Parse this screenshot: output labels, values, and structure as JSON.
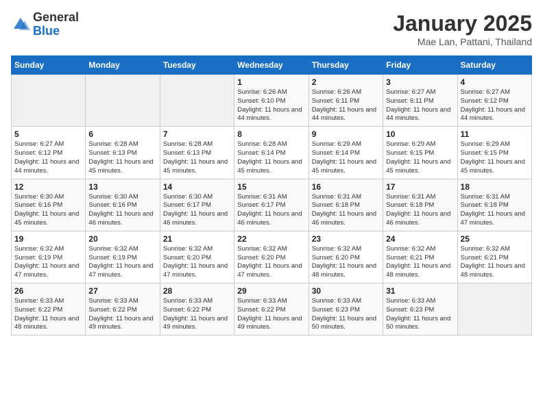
{
  "logo": {
    "general": "General",
    "blue": "Blue"
  },
  "header": {
    "title": "January 2025",
    "location": "Mae Lan, Pattani, Thailand"
  },
  "weekdays": [
    "Sunday",
    "Monday",
    "Tuesday",
    "Wednesday",
    "Thursday",
    "Friday",
    "Saturday"
  ],
  "weeks": [
    [
      {
        "day": "",
        "sunrise": "",
        "sunset": "",
        "daylight": "",
        "empty": true
      },
      {
        "day": "",
        "sunrise": "",
        "sunset": "",
        "daylight": "",
        "empty": true
      },
      {
        "day": "",
        "sunrise": "",
        "sunset": "",
        "daylight": "",
        "empty": true
      },
      {
        "day": "1",
        "sunrise": "Sunrise: 6:26 AM",
        "sunset": "Sunset: 6:10 PM",
        "daylight": "Daylight: 11 hours and 44 minutes.",
        "empty": false
      },
      {
        "day": "2",
        "sunrise": "Sunrise: 6:26 AM",
        "sunset": "Sunset: 6:11 PM",
        "daylight": "Daylight: 11 hours and 44 minutes.",
        "empty": false
      },
      {
        "day": "3",
        "sunrise": "Sunrise: 6:27 AM",
        "sunset": "Sunset: 6:11 PM",
        "daylight": "Daylight: 11 hours and 44 minutes.",
        "empty": false
      },
      {
        "day": "4",
        "sunrise": "Sunrise: 6:27 AM",
        "sunset": "Sunset: 6:12 PM",
        "daylight": "Daylight: 11 hours and 44 minutes.",
        "empty": false
      }
    ],
    [
      {
        "day": "5",
        "sunrise": "Sunrise: 6:27 AM",
        "sunset": "Sunset: 6:12 PM",
        "daylight": "Daylight: 11 hours and 44 minutes.",
        "empty": false
      },
      {
        "day": "6",
        "sunrise": "Sunrise: 6:28 AM",
        "sunset": "Sunset: 6:13 PM",
        "daylight": "Daylight: 11 hours and 45 minutes.",
        "empty": false
      },
      {
        "day": "7",
        "sunrise": "Sunrise: 6:28 AM",
        "sunset": "Sunset: 6:13 PM",
        "daylight": "Daylight: 11 hours and 45 minutes.",
        "empty": false
      },
      {
        "day": "8",
        "sunrise": "Sunrise: 6:28 AM",
        "sunset": "Sunset: 6:14 PM",
        "daylight": "Daylight: 11 hours and 45 minutes.",
        "empty": false
      },
      {
        "day": "9",
        "sunrise": "Sunrise: 6:29 AM",
        "sunset": "Sunset: 6:14 PM",
        "daylight": "Daylight: 11 hours and 45 minutes.",
        "empty": false
      },
      {
        "day": "10",
        "sunrise": "Sunrise: 6:29 AM",
        "sunset": "Sunset: 6:15 PM",
        "daylight": "Daylight: 11 hours and 45 minutes.",
        "empty": false
      },
      {
        "day": "11",
        "sunrise": "Sunrise: 6:29 AM",
        "sunset": "Sunset: 6:15 PM",
        "daylight": "Daylight: 11 hours and 45 minutes.",
        "empty": false
      }
    ],
    [
      {
        "day": "12",
        "sunrise": "Sunrise: 6:30 AM",
        "sunset": "Sunset: 6:16 PM",
        "daylight": "Daylight: 11 hours and 45 minutes.",
        "empty": false
      },
      {
        "day": "13",
        "sunrise": "Sunrise: 6:30 AM",
        "sunset": "Sunset: 6:16 PM",
        "daylight": "Daylight: 11 hours and 46 minutes.",
        "empty": false
      },
      {
        "day": "14",
        "sunrise": "Sunrise: 6:30 AM",
        "sunset": "Sunset: 6:17 PM",
        "daylight": "Daylight: 11 hours and 46 minutes.",
        "empty": false
      },
      {
        "day": "15",
        "sunrise": "Sunrise: 6:31 AM",
        "sunset": "Sunset: 6:17 PM",
        "daylight": "Daylight: 11 hours and 46 minutes.",
        "empty": false
      },
      {
        "day": "16",
        "sunrise": "Sunrise: 6:31 AM",
        "sunset": "Sunset: 6:18 PM",
        "daylight": "Daylight: 11 hours and 46 minutes.",
        "empty": false
      },
      {
        "day": "17",
        "sunrise": "Sunrise: 6:31 AM",
        "sunset": "Sunset: 6:18 PM",
        "daylight": "Daylight: 11 hours and 46 minutes.",
        "empty": false
      },
      {
        "day": "18",
        "sunrise": "Sunrise: 6:31 AM",
        "sunset": "Sunset: 6:18 PM",
        "daylight": "Daylight: 11 hours and 47 minutes.",
        "empty": false
      }
    ],
    [
      {
        "day": "19",
        "sunrise": "Sunrise: 6:32 AM",
        "sunset": "Sunset: 6:19 PM",
        "daylight": "Daylight: 11 hours and 47 minutes.",
        "empty": false
      },
      {
        "day": "20",
        "sunrise": "Sunrise: 6:32 AM",
        "sunset": "Sunset: 6:19 PM",
        "daylight": "Daylight: 11 hours and 47 minutes.",
        "empty": false
      },
      {
        "day": "21",
        "sunrise": "Sunrise: 6:32 AM",
        "sunset": "Sunset: 6:20 PM",
        "daylight": "Daylight: 11 hours and 47 minutes.",
        "empty": false
      },
      {
        "day": "22",
        "sunrise": "Sunrise: 6:32 AM",
        "sunset": "Sunset: 6:20 PM",
        "daylight": "Daylight: 11 hours and 47 minutes.",
        "empty": false
      },
      {
        "day": "23",
        "sunrise": "Sunrise: 6:32 AM",
        "sunset": "Sunset: 6:20 PM",
        "daylight": "Daylight: 11 hours and 48 minutes.",
        "empty": false
      },
      {
        "day": "24",
        "sunrise": "Sunrise: 6:32 AM",
        "sunset": "Sunset: 6:21 PM",
        "daylight": "Daylight: 11 hours and 48 minutes.",
        "empty": false
      },
      {
        "day": "25",
        "sunrise": "Sunrise: 6:32 AM",
        "sunset": "Sunset: 6:21 PM",
        "daylight": "Daylight: 11 hours and 48 minutes.",
        "empty": false
      }
    ],
    [
      {
        "day": "26",
        "sunrise": "Sunrise: 6:33 AM",
        "sunset": "Sunset: 6:22 PM",
        "daylight": "Daylight: 11 hours and 48 minutes.",
        "empty": false
      },
      {
        "day": "27",
        "sunrise": "Sunrise: 6:33 AM",
        "sunset": "Sunset: 6:22 PM",
        "daylight": "Daylight: 11 hours and 49 minutes.",
        "empty": false
      },
      {
        "day": "28",
        "sunrise": "Sunrise: 6:33 AM",
        "sunset": "Sunset: 6:22 PM",
        "daylight": "Daylight: 11 hours and 49 minutes.",
        "empty": false
      },
      {
        "day": "29",
        "sunrise": "Sunrise: 6:33 AM",
        "sunset": "Sunset: 6:22 PM",
        "daylight": "Daylight: 11 hours and 49 minutes.",
        "empty": false
      },
      {
        "day": "30",
        "sunrise": "Sunrise: 6:33 AM",
        "sunset": "Sunset: 6:23 PM",
        "daylight": "Daylight: 11 hours and 50 minutes.",
        "empty": false
      },
      {
        "day": "31",
        "sunrise": "Sunrise: 6:33 AM",
        "sunset": "Sunset: 6:23 PM",
        "daylight": "Daylight: 11 hours and 50 minutes.",
        "empty": false
      },
      {
        "day": "",
        "sunrise": "",
        "sunset": "",
        "daylight": "",
        "empty": true
      }
    ]
  ]
}
